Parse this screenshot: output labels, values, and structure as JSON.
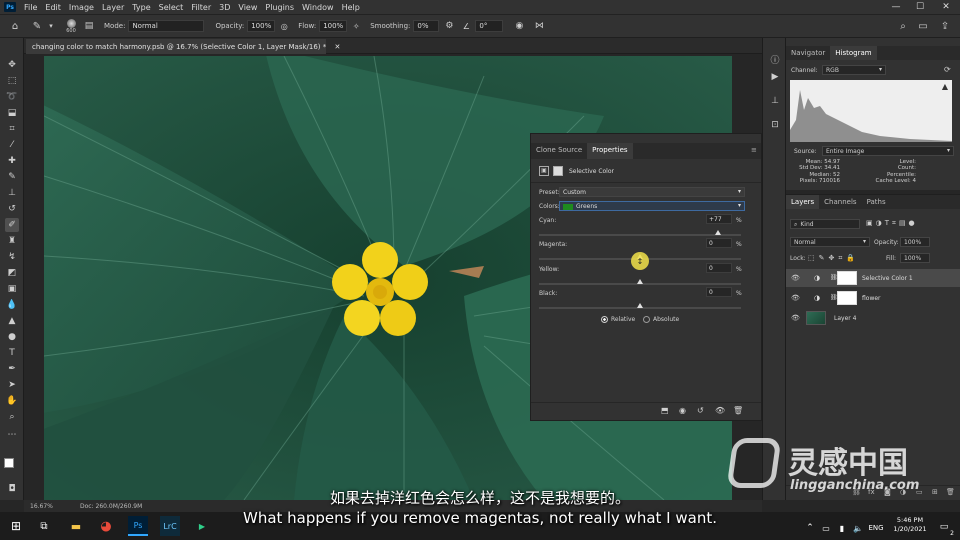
{
  "menu": {
    "items": [
      "File",
      "Edit",
      "Image",
      "Layer",
      "Type",
      "Select",
      "Filter",
      "3D",
      "View",
      "Plugins",
      "Window",
      "Help"
    ]
  },
  "window_controls": {
    "minimize": "—",
    "maximize": "☐",
    "close": "✕"
  },
  "options_bar": {
    "brush_size": "600",
    "mode_label": "Mode:",
    "mode_value": "Normal",
    "opacity_label": "Opacity:",
    "opacity_value": "100%",
    "flow_label": "Flow:",
    "flow_value": "100%",
    "smoothing_label": "Smoothing:",
    "smoothing_value": "0%",
    "angle_value": "0°"
  },
  "document": {
    "tab_title": "changing color to match harmony.psb @ 16.7% (Selective Color 1, Layer Mask/16) *",
    "zoom": "16.67%",
    "doc_size": "Doc: 260.0M/260.9M"
  },
  "navigator": {
    "tabs": [
      "Navigator",
      "Histogram"
    ],
    "channel_label": "Channel:",
    "channel_value": "RGB",
    "source_label": "Source:",
    "source_value": "Entire Image",
    "stats_left": [
      {
        "label": "Mean:",
        "value": "54.97"
      },
      {
        "label": "Std Dev:",
        "value": "34.41"
      },
      {
        "label": "Median:",
        "value": "52"
      },
      {
        "label": "Pixels:",
        "value": "710016"
      }
    ],
    "stats_right": [
      {
        "label": "Level:",
        "value": ""
      },
      {
        "label": "Count:",
        "value": ""
      },
      {
        "label": "Percentile:",
        "value": ""
      },
      {
        "label": "Cache Level:",
        "value": "4"
      }
    ]
  },
  "properties": {
    "tabs": [
      "Clone Source",
      "Properties"
    ],
    "adjustment_name": "Selective Color",
    "preset_label": "Preset:",
    "preset_value": "Custom",
    "colors_label": "Colors:",
    "colors_value": "Greens",
    "colors_swatch": "#1e8a1e",
    "sliders": [
      {
        "label": "Cyan:",
        "value": "+77",
        "pct": "%",
        "position": 0.885
      },
      {
        "label": "Magenta:",
        "value": "0",
        "pct": "%",
        "position": 0.5
      },
      {
        "label": "Yellow:",
        "value": "0",
        "pct": "%",
        "position": 0.5
      },
      {
        "label": "Black:",
        "value": "0",
        "pct": "%",
        "position": 0.5
      }
    ],
    "method_relative": "Relative",
    "method_absolute": "Absolute"
  },
  "layers": {
    "tabs": [
      "Layers",
      "Channels",
      "Paths"
    ],
    "filter_kind": "Kind",
    "blend_mode": "Normal",
    "opacity_label": "Opacity:",
    "opacity_value": "100%",
    "lock_label": "Lock:",
    "fill_label": "Fill:",
    "fill_value": "100%",
    "items": [
      {
        "name": "Selective Color 1",
        "selected": true
      },
      {
        "name": "flower",
        "selected": false
      },
      {
        "name": "Layer 4",
        "selected": false
      }
    ]
  },
  "subtitles": {
    "chinese": "如果去掉洋红色会怎么样，这不是我想要的。",
    "english": "What happens if you remove magentas, not really what I want."
  },
  "watermark": {
    "brand": "灵感中国",
    "url": "lingganchina.com"
  },
  "taskbar": {
    "lang": "ENG",
    "time": "5:46 PM",
    "date": "1/20/2021",
    "notification_count": "2",
    "lrc_label": "LrC",
    "ps_label": "Ps"
  },
  "colors": {
    "ui_dark": "#323232",
    "accent_blue": "#31a8ff",
    "leaf_green": "#1f4a3a",
    "flower_yellow": "#f2d21b"
  }
}
